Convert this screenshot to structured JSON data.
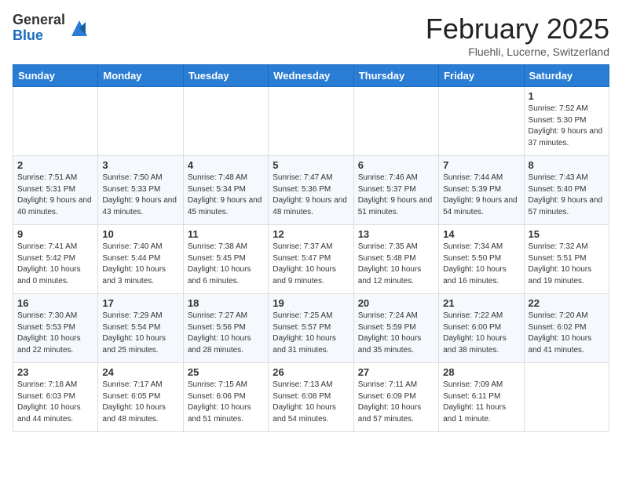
{
  "logo": {
    "general": "General",
    "blue": "Blue"
  },
  "title": "February 2025",
  "location": "Fluehli, Lucerne, Switzerland",
  "days_of_week": [
    "Sunday",
    "Monday",
    "Tuesday",
    "Wednesday",
    "Thursday",
    "Friday",
    "Saturday"
  ],
  "weeks": [
    [
      {
        "day": "",
        "info": ""
      },
      {
        "day": "",
        "info": ""
      },
      {
        "day": "",
        "info": ""
      },
      {
        "day": "",
        "info": ""
      },
      {
        "day": "",
        "info": ""
      },
      {
        "day": "",
        "info": ""
      },
      {
        "day": "1",
        "info": "Sunrise: 7:52 AM\nSunset: 5:30 PM\nDaylight: 9 hours and 37 minutes."
      }
    ],
    [
      {
        "day": "2",
        "info": "Sunrise: 7:51 AM\nSunset: 5:31 PM\nDaylight: 9 hours and 40 minutes."
      },
      {
        "day": "3",
        "info": "Sunrise: 7:50 AM\nSunset: 5:33 PM\nDaylight: 9 hours and 43 minutes."
      },
      {
        "day": "4",
        "info": "Sunrise: 7:48 AM\nSunset: 5:34 PM\nDaylight: 9 hours and 45 minutes."
      },
      {
        "day": "5",
        "info": "Sunrise: 7:47 AM\nSunset: 5:36 PM\nDaylight: 9 hours and 48 minutes."
      },
      {
        "day": "6",
        "info": "Sunrise: 7:46 AM\nSunset: 5:37 PM\nDaylight: 9 hours and 51 minutes."
      },
      {
        "day": "7",
        "info": "Sunrise: 7:44 AM\nSunset: 5:39 PM\nDaylight: 9 hours and 54 minutes."
      },
      {
        "day": "8",
        "info": "Sunrise: 7:43 AM\nSunset: 5:40 PM\nDaylight: 9 hours and 57 minutes."
      }
    ],
    [
      {
        "day": "9",
        "info": "Sunrise: 7:41 AM\nSunset: 5:42 PM\nDaylight: 10 hours and 0 minutes."
      },
      {
        "day": "10",
        "info": "Sunrise: 7:40 AM\nSunset: 5:44 PM\nDaylight: 10 hours and 3 minutes."
      },
      {
        "day": "11",
        "info": "Sunrise: 7:38 AM\nSunset: 5:45 PM\nDaylight: 10 hours and 6 minutes."
      },
      {
        "day": "12",
        "info": "Sunrise: 7:37 AM\nSunset: 5:47 PM\nDaylight: 10 hours and 9 minutes."
      },
      {
        "day": "13",
        "info": "Sunrise: 7:35 AM\nSunset: 5:48 PM\nDaylight: 10 hours and 12 minutes."
      },
      {
        "day": "14",
        "info": "Sunrise: 7:34 AM\nSunset: 5:50 PM\nDaylight: 10 hours and 16 minutes."
      },
      {
        "day": "15",
        "info": "Sunrise: 7:32 AM\nSunset: 5:51 PM\nDaylight: 10 hours and 19 minutes."
      }
    ],
    [
      {
        "day": "16",
        "info": "Sunrise: 7:30 AM\nSunset: 5:53 PM\nDaylight: 10 hours and 22 minutes."
      },
      {
        "day": "17",
        "info": "Sunrise: 7:29 AM\nSunset: 5:54 PM\nDaylight: 10 hours and 25 minutes."
      },
      {
        "day": "18",
        "info": "Sunrise: 7:27 AM\nSunset: 5:56 PM\nDaylight: 10 hours and 28 minutes."
      },
      {
        "day": "19",
        "info": "Sunrise: 7:25 AM\nSunset: 5:57 PM\nDaylight: 10 hours and 31 minutes."
      },
      {
        "day": "20",
        "info": "Sunrise: 7:24 AM\nSunset: 5:59 PM\nDaylight: 10 hours and 35 minutes."
      },
      {
        "day": "21",
        "info": "Sunrise: 7:22 AM\nSunset: 6:00 PM\nDaylight: 10 hours and 38 minutes."
      },
      {
        "day": "22",
        "info": "Sunrise: 7:20 AM\nSunset: 6:02 PM\nDaylight: 10 hours and 41 minutes."
      }
    ],
    [
      {
        "day": "23",
        "info": "Sunrise: 7:18 AM\nSunset: 6:03 PM\nDaylight: 10 hours and 44 minutes."
      },
      {
        "day": "24",
        "info": "Sunrise: 7:17 AM\nSunset: 6:05 PM\nDaylight: 10 hours and 48 minutes."
      },
      {
        "day": "25",
        "info": "Sunrise: 7:15 AM\nSunset: 6:06 PM\nDaylight: 10 hours and 51 minutes."
      },
      {
        "day": "26",
        "info": "Sunrise: 7:13 AM\nSunset: 6:08 PM\nDaylight: 10 hours and 54 minutes."
      },
      {
        "day": "27",
        "info": "Sunrise: 7:11 AM\nSunset: 6:09 PM\nDaylight: 10 hours and 57 minutes."
      },
      {
        "day": "28",
        "info": "Sunrise: 7:09 AM\nSunset: 6:11 PM\nDaylight: 11 hours and 1 minute."
      },
      {
        "day": "",
        "info": ""
      }
    ]
  ]
}
